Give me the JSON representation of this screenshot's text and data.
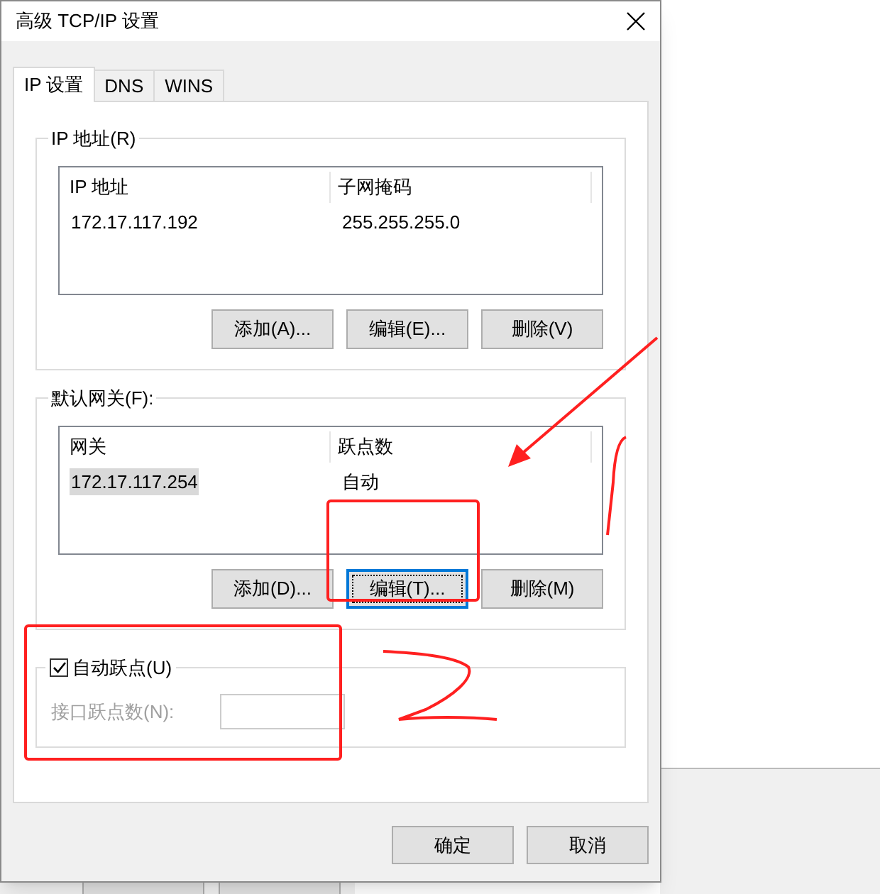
{
  "window": {
    "title": "高级 TCP/IP 设置"
  },
  "tabs": [
    {
      "label": "IP 设置",
      "selected": true
    },
    {
      "label": "DNS",
      "selected": false
    },
    {
      "label": "WINS",
      "selected": false
    }
  ],
  "ip_group": {
    "legend": "IP 地址(R)",
    "columns": [
      "IP 地址",
      "子网掩码"
    ],
    "rows": [
      {
        "cells": [
          "172.17.117.192",
          "255.255.255.0"
        ],
        "selected": false
      }
    ],
    "buttons": [
      {
        "label": "添加(A)...",
        "focused": false
      },
      {
        "label": "编辑(E)...",
        "focused": false
      },
      {
        "label": "删除(V)",
        "focused": false
      }
    ]
  },
  "gateway_group": {
    "legend": "默认网关(F):",
    "columns": [
      "网关",
      "跃点数"
    ],
    "rows": [
      {
        "cells": [
          "172.17.117.254",
          "自动"
        ],
        "selected": true
      }
    ],
    "buttons": [
      {
        "label": "添加(D)...",
        "focused": false
      },
      {
        "label": "编辑(T)...",
        "focused": true
      },
      {
        "label": "删除(M)",
        "focused": false
      }
    ]
  },
  "metric_group": {
    "legend": "自动跃点(U)",
    "checked": true,
    "field_label": "接口跃点数(N):",
    "field_disabled": true
  },
  "footer_buttons": [
    "确定",
    "取消"
  ]
}
